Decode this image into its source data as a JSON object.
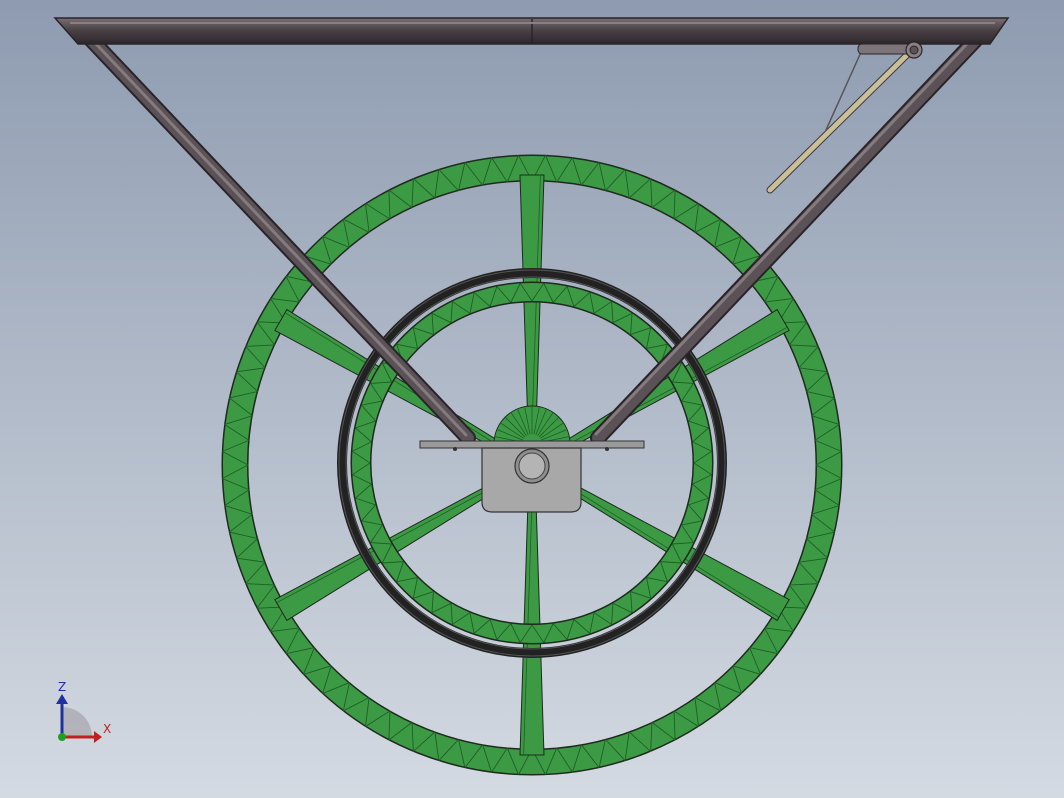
{
  "viewport": {
    "background_top": "#8e9bb0",
    "background_bottom": "#d4dae2"
  },
  "colors": {
    "frame_tube": "#4a4246",
    "frame_tube_highlight": "#7a7074",
    "wheel_green": "#3c9a44",
    "wheel_green_dark": "#1f5e26",
    "outline": "#1e2a1e",
    "tire_black": "#222222",
    "hub_gray": "#a8a8a8",
    "plate_gray": "#9a9a9a",
    "handle_tan": "#cbbf99",
    "axis_z": "#2030a0",
    "axis_x": "#c02020",
    "axis_y": "#20a020"
  },
  "triad": {
    "z_label": "Z",
    "x_label": "X"
  }
}
